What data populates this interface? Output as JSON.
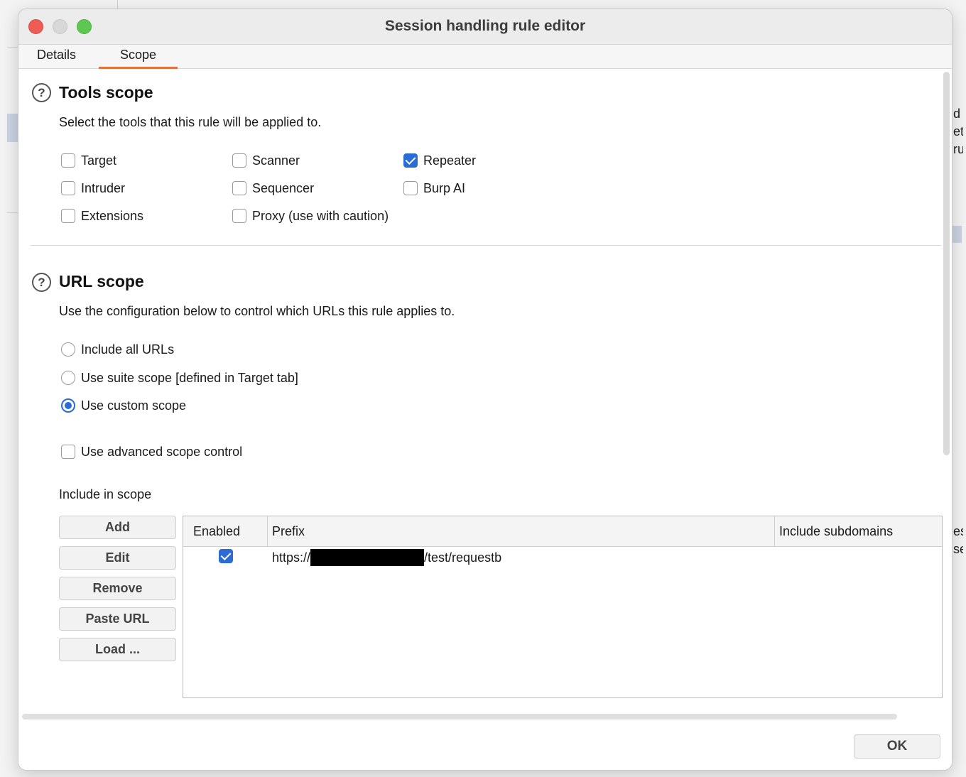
{
  "window": {
    "title": "Session handling rule editor"
  },
  "tabs": [
    {
      "label": "Details",
      "active": false
    },
    {
      "label": "Scope",
      "active": true
    }
  ],
  "tools_scope": {
    "title": "Tools scope",
    "description": "Select the tools that this rule will be applied to.",
    "tools": [
      {
        "label": "Target",
        "checked": false
      },
      {
        "label": "Scanner",
        "checked": false
      },
      {
        "label": "Repeater",
        "checked": true
      },
      {
        "label": "Intruder",
        "checked": false
      },
      {
        "label": "Sequencer",
        "checked": false
      },
      {
        "label": "Burp AI",
        "checked": false
      },
      {
        "label": "Extensions",
        "checked": false
      },
      {
        "label": "Proxy (use with caution)",
        "checked": false
      }
    ]
  },
  "url_scope": {
    "title": "URL scope",
    "description": "Use the configuration below to control which URLs this rule applies to.",
    "options": [
      {
        "label": "Include all URLs",
        "selected": false
      },
      {
        "label": "Use suite scope [defined in Target tab]",
        "selected": false
      },
      {
        "label": "Use custom scope",
        "selected": true
      }
    ],
    "advanced": {
      "label": "Use advanced scope control",
      "checked": false
    },
    "include_label": "Include in scope",
    "buttons": {
      "add": "Add",
      "edit": "Edit",
      "remove": "Remove",
      "paste_url": "Paste URL",
      "load": "Load ..."
    },
    "table": {
      "columns": [
        "Enabled",
        "Prefix",
        "Include subdomains"
      ],
      "rows": [
        {
          "enabled": true,
          "prefix_start": "https://",
          "prefix_end": "/test/requestb",
          "include_subdomains": ""
        }
      ]
    }
  },
  "footer": {
    "ok": "OK"
  },
  "background_text": [
    "d s",
    "et",
    "ru",
    "es",
    "se"
  ],
  "colors": {
    "accent": "#2b6bd6",
    "tab_underline": "#e8703c",
    "close": "#ee5d55",
    "maximize": "#5dc84f"
  }
}
